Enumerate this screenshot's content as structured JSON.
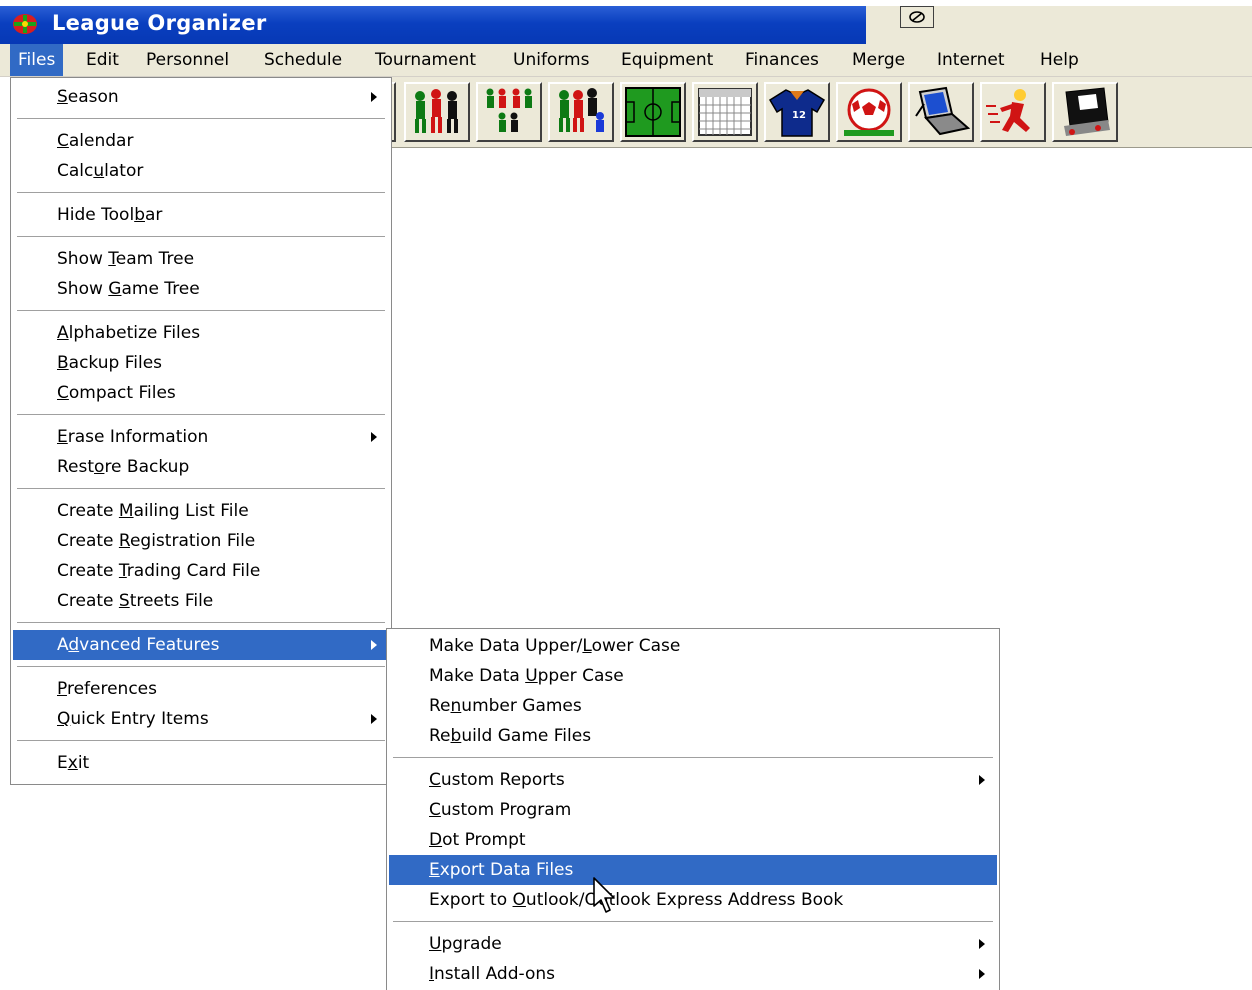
{
  "window": {
    "title": "League Organizer",
    "accent": "#0a3fbf",
    "highlight": "#316ac5"
  },
  "menubar": [
    "Files",
    "Edit",
    "Personnel",
    "Schedule",
    "Tournament",
    "Uniforms",
    "Equipment",
    "Finances",
    "Merge",
    "Internet",
    "Help"
  ],
  "files_menu": [
    {
      "pre": "",
      "u": "S",
      "post": "eason",
      "submenu": true
    },
    {
      "sep": true
    },
    {
      "pre": "",
      "u": "C",
      "post": "alendar"
    },
    {
      "pre": "Calc",
      "u": "u",
      "post": "lator"
    },
    {
      "sep": true
    },
    {
      "pre": "Hide Tool",
      "u": "b",
      "post": "ar"
    },
    {
      "sep": true
    },
    {
      "pre": "Show ",
      "u": "T",
      "post": "eam Tree"
    },
    {
      "pre": "Show ",
      "u": "G",
      "post": "ame Tree"
    },
    {
      "sep": true
    },
    {
      "pre": "",
      "u": "A",
      "post": "lphabetize Files"
    },
    {
      "pre": "",
      "u": "B",
      "post": "ackup Files"
    },
    {
      "pre": "",
      "u": "C",
      "post": "ompact Files"
    },
    {
      "sep": true
    },
    {
      "pre": "",
      "u": "E",
      "post": "rase Information",
      "submenu": true
    },
    {
      "pre": "Rest",
      "u": "o",
      "post": "re Backup"
    },
    {
      "sep": true
    },
    {
      "pre": "Create ",
      "u": "M",
      "post": "ailing List File"
    },
    {
      "pre": "Create ",
      "u": "R",
      "post": "egistration File"
    },
    {
      "pre": "Create ",
      "u": "T",
      "post": "rading Card File"
    },
    {
      "pre": "Create ",
      "u": "S",
      "post": "treets File"
    },
    {
      "sep": true
    },
    {
      "pre": "A",
      "u": "d",
      "post": "vanced Features",
      "submenu": true,
      "highlight": true
    },
    {
      "sep": true
    },
    {
      "pre": "",
      "u": "P",
      "post": "references"
    },
    {
      "pre": "",
      "u": "Q",
      "post": "uick Entry Items",
      "submenu": true
    },
    {
      "sep": true
    },
    {
      "pre": "E",
      "u": "x",
      "post": "it"
    }
  ],
  "advanced_menu": [
    {
      "pre": "Make Data Upper/",
      "u": "L",
      "post": "ower Case"
    },
    {
      "pre": "Make Data ",
      "u": "U",
      "post": "pper Case"
    },
    {
      "pre": "Re",
      "u": "n",
      "post": "umber Games"
    },
    {
      "pre": "Re",
      "u": "b",
      "post": "uild Game Files"
    },
    {
      "sep": true
    },
    {
      "pre": "",
      "u": "C",
      "post": "ustom Reports",
      "submenu": true
    },
    {
      "pre": "",
      "u": "C",
      "post": "ustom Program"
    },
    {
      "pre": "",
      "u": "D",
      "post": "ot Prompt"
    },
    {
      "pre": "",
      "u": "E",
      "post": "xport Data Files",
      "highlight": true
    },
    {
      "pre": "Export to ",
      "u": "O",
      "post": "utlook/Outlook Express Address Book"
    },
    {
      "sep": true
    },
    {
      "pre": "",
      "u": "U",
      "post": "pgrade",
      "submenu": true
    },
    {
      "pre": "",
      "u": "I",
      "post": "nstall Add-ons",
      "submenu": true
    }
  ],
  "toolbar_icons": [
    "players-icon",
    "teams-icon",
    "coaches-icon",
    "field-icon",
    "calendar-icon",
    "jersey-icon",
    "soccer-ball-icon",
    "laptop-icon",
    "runner-icon",
    "cleat-icon"
  ],
  "jersey_number": "12"
}
